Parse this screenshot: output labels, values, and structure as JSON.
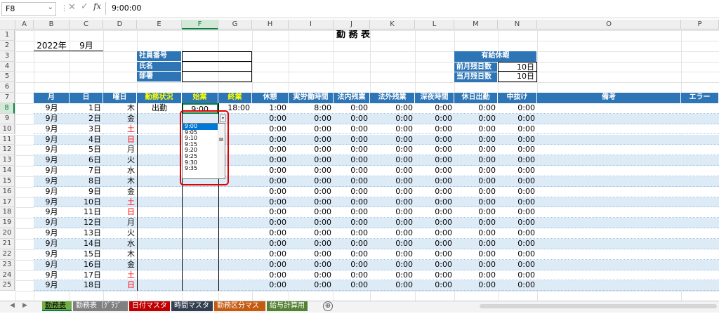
{
  "formula_bar": {
    "name_box": "F8",
    "cancel": "✕",
    "enter": "✓",
    "fx": "fx",
    "content": "9:00:00"
  },
  "columns": [
    "A",
    "B",
    "C",
    "D",
    "E",
    "F",
    "G",
    "H",
    "I",
    "J",
    "K",
    "L",
    "M",
    "N",
    "O",
    "P"
  ],
  "selected_column": "F",
  "rows": [
    "1",
    "2",
    "3",
    "4",
    "5",
    "6",
    "7",
    "8",
    "9",
    "10",
    "11",
    "12",
    "13",
    "14",
    "15",
    "16",
    "17",
    "18",
    "19",
    "20",
    "21",
    "22",
    "23",
    "24",
    "25"
  ],
  "selected_row": "8",
  "sheet": {
    "title": "勤 務 表",
    "year": "2022年",
    "month": "9月",
    "info_labels": [
      "社員番号",
      "氏名",
      "部署"
    ],
    "paid_leave": {
      "header": "有給休暇",
      "prev_label": "前月残日数",
      "prev_value": "10日",
      "curr_label": "当月残日数",
      "curr_value": "10日"
    },
    "headers": [
      "月",
      "日",
      "曜日",
      "勤務状況",
      "始業",
      "終業",
      "休憩",
      "実労働時間",
      "法内残業",
      "法外残業",
      "深夜時間",
      "休日出勤",
      "中抜け",
      "備考",
      "エラー"
    ],
    "first_row": {
      "status": "出勤",
      "start": "9:00",
      "end": "18:00",
      "break": "1:00",
      "work": "8:00"
    },
    "zero": "0:00",
    "days": [
      {
        "m": "9月",
        "d": "1日",
        "w": "木",
        "red": false
      },
      {
        "m": "9月",
        "d": "2日",
        "w": "金",
        "red": false
      },
      {
        "m": "9月",
        "d": "3日",
        "w": "土",
        "red": true
      },
      {
        "m": "9月",
        "d": "4日",
        "w": "日",
        "red": true
      },
      {
        "m": "9月",
        "d": "5日",
        "w": "月",
        "red": false
      },
      {
        "m": "9月",
        "d": "6日",
        "w": "火",
        "red": false
      },
      {
        "m": "9月",
        "d": "7日",
        "w": "水",
        "red": false
      },
      {
        "m": "9月",
        "d": "8日",
        "w": "木",
        "red": false
      },
      {
        "m": "9月",
        "d": "9日",
        "w": "金",
        "red": false
      },
      {
        "m": "9月",
        "d": "10日",
        "w": "土",
        "red": true
      },
      {
        "m": "9月",
        "d": "11日",
        "w": "日",
        "red": true
      },
      {
        "m": "9月",
        "d": "12日",
        "w": "月",
        "red": false
      },
      {
        "m": "9月",
        "d": "13日",
        "w": "火",
        "red": false
      },
      {
        "m": "9月",
        "d": "14日",
        "w": "水",
        "red": false
      },
      {
        "m": "9月",
        "d": "15日",
        "w": "木",
        "red": false
      },
      {
        "m": "9月",
        "d": "16日",
        "w": "金",
        "red": false
      },
      {
        "m": "9月",
        "d": "17日",
        "w": "土",
        "red": true
      },
      {
        "m": "9月",
        "d": "18日",
        "w": "日",
        "red": true
      }
    ]
  },
  "dropdown": {
    "options": [
      "9:00",
      "9:05",
      "9:10",
      "9:15",
      "9:20",
      "9:25",
      "9:30",
      "9:35"
    ],
    "selected": "9:00"
  },
  "tabs": [
    {
      "label": "勤務表",
      "color": "#70ad47",
      "text": "#000000"
    },
    {
      "label": "勤務表（ｸﾞﾗﾌﾞ1）",
      "color": "#808080",
      "text": "#ffffff"
    },
    {
      "label": "日付マスタ",
      "color": "#c00000",
      "text": "#ffffff"
    },
    {
      "label": "時間マスタ",
      "color": "#333f50",
      "text": "#ffffff"
    },
    {
      "label": "勤務区分マスタ",
      "color": "#c55a11",
      "text": "#ffffff"
    },
    {
      "label": "給与計算用",
      "color": "#548235",
      "text": "#ffffff"
    }
  ],
  "add_sheet": "⊕",
  "colors": {
    "header_blue": "#2e75b6",
    "row_blue": "#ddebf7",
    "accent_green": "#107c41",
    "weekend_red": "#ff0000",
    "highlight_red": "#e00000"
  }
}
